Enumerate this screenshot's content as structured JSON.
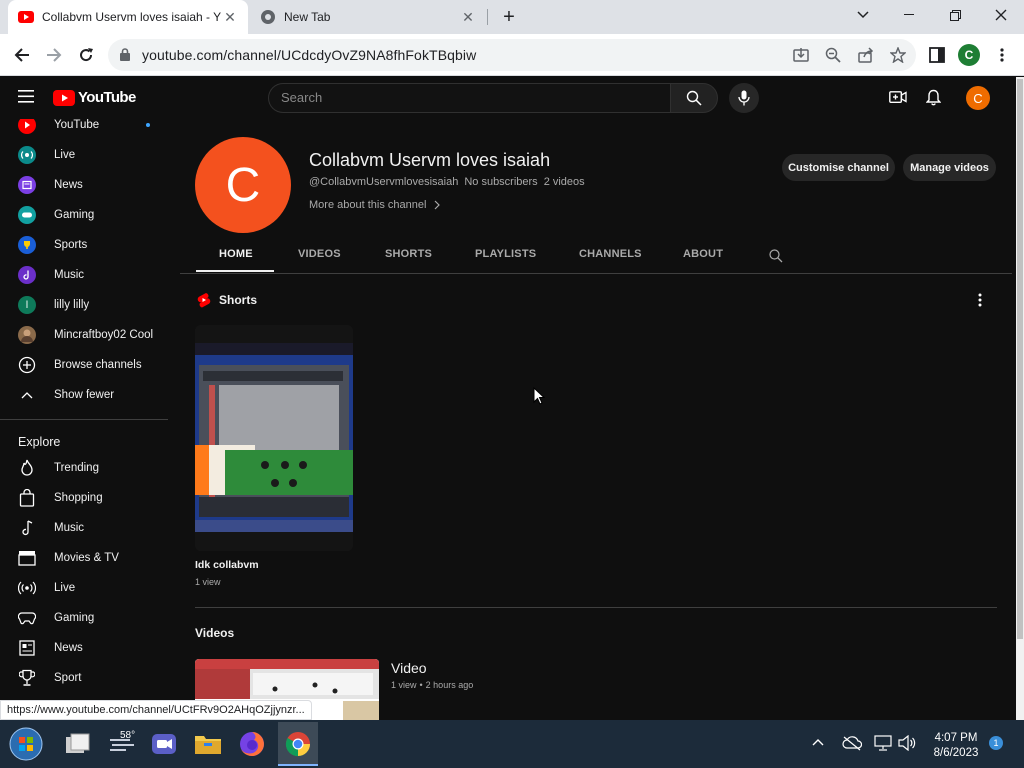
{
  "browser": {
    "tabs": [
      {
        "title": "Collabvm Uservm loves isaiah - Y",
        "active": true
      },
      {
        "title": "New Tab",
        "active": false
      }
    ],
    "url": "youtube.com/channel/UCdcdyOvZ9NA8fhFokTBqbiw",
    "profile_initial": "C",
    "status_url": "https://www.youtube.com/channel/UCtFRv9O2AHqOZjjynzr..."
  },
  "youtube": {
    "logo_text": "YouTube",
    "search_placeholder": "Search",
    "avatar_initial": "C",
    "brand_color": "#ff0000"
  },
  "sidebar": {
    "subscriptions": [
      {
        "label": "YouTube",
        "icon": "youtube-channel-icon",
        "new": true
      },
      {
        "label": "Live",
        "icon": "live-channel-icon"
      },
      {
        "label": "News",
        "icon": "news-channel-icon"
      },
      {
        "label": "Gaming",
        "icon": "gaming-channel-icon"
      },
      {
        "label": "Sports",
        "icon": "sports-channel-icon"
      },
      {
        "label": "Music",
        "icon": "music-channel-icon"
      },
      {
        "label": "lilly lilly",
        "icon": "user-avatar-icon",
        "initial": "l"
      },
      {
        "label": "Mincraftboy02 Cool",
        "icon": "user-avatar-icon"
      },
      {
        "label": "Browse channels",
        "icon": "add-circle-icon"
      },
      {
        "label": "Show fewer",
        "icon": "chevron-up-icon"
      }
    ],
    "explore_title": "Explore",
    "explore": [
      {
        "label": "Trending",
        "icon": "trending-icon"
      },
      {
        "label": "Shopping",
        "icon": "shopping-icon"
      },
      {
        "label": "Music",
        "icon": "music-note-icon"
      },
      {
        "label": "Movies & TV",
        "icon": "clapperboard-icon"
      },
      {
        "label": "Live",
        "icon": "live-icon"
      },
      {
        "label": "Gaming",
        "icon": "gamepad-icon"
      },
      {
        "label": "News",
        "icon": "newspaper-icon"
      },
      {
        "label": "Sport",
        "icon": "trophy-icon"
      }
    ]
  },
  "channel": {
    "avatar_initial": "C",
    "name": "Collabvm Uservm loves isaiah",
    "handle": "@CollabvmUservmlovesisaiah",
    "subscribers": "No subscribers",
    "video_count": "2 videos",
    "more_about": "More about this channel",
    "customise_label": "Customise channel",
    "manage_label": "Manage videos",
    "tabs": [
      "HOME",
      "VIDEOS",
      "SHORTS",
      "PLAYLISTS",
      "CHANNELS",
      "ABOUT"
    ],
    "active_tab": "HOME"
  },
  "shorts": {
    "section_title": "Shorts",
    "items": [
      {
        "title": "Idk collabvm",
        "views": "1 view"
      }
    ]
  },
  "videos": {
    "section_title": "Videos",
    "items": [
      {
        "title": "Video",
        "views": "1 view",
        "age": "2 hours ago"
      }
    ]
  },
  "taskbar": {
    "weather": "58°",
    "time": "4:07 PM",
    "date": "8/6/2023",
    "notification_count": "1"
  }
}
